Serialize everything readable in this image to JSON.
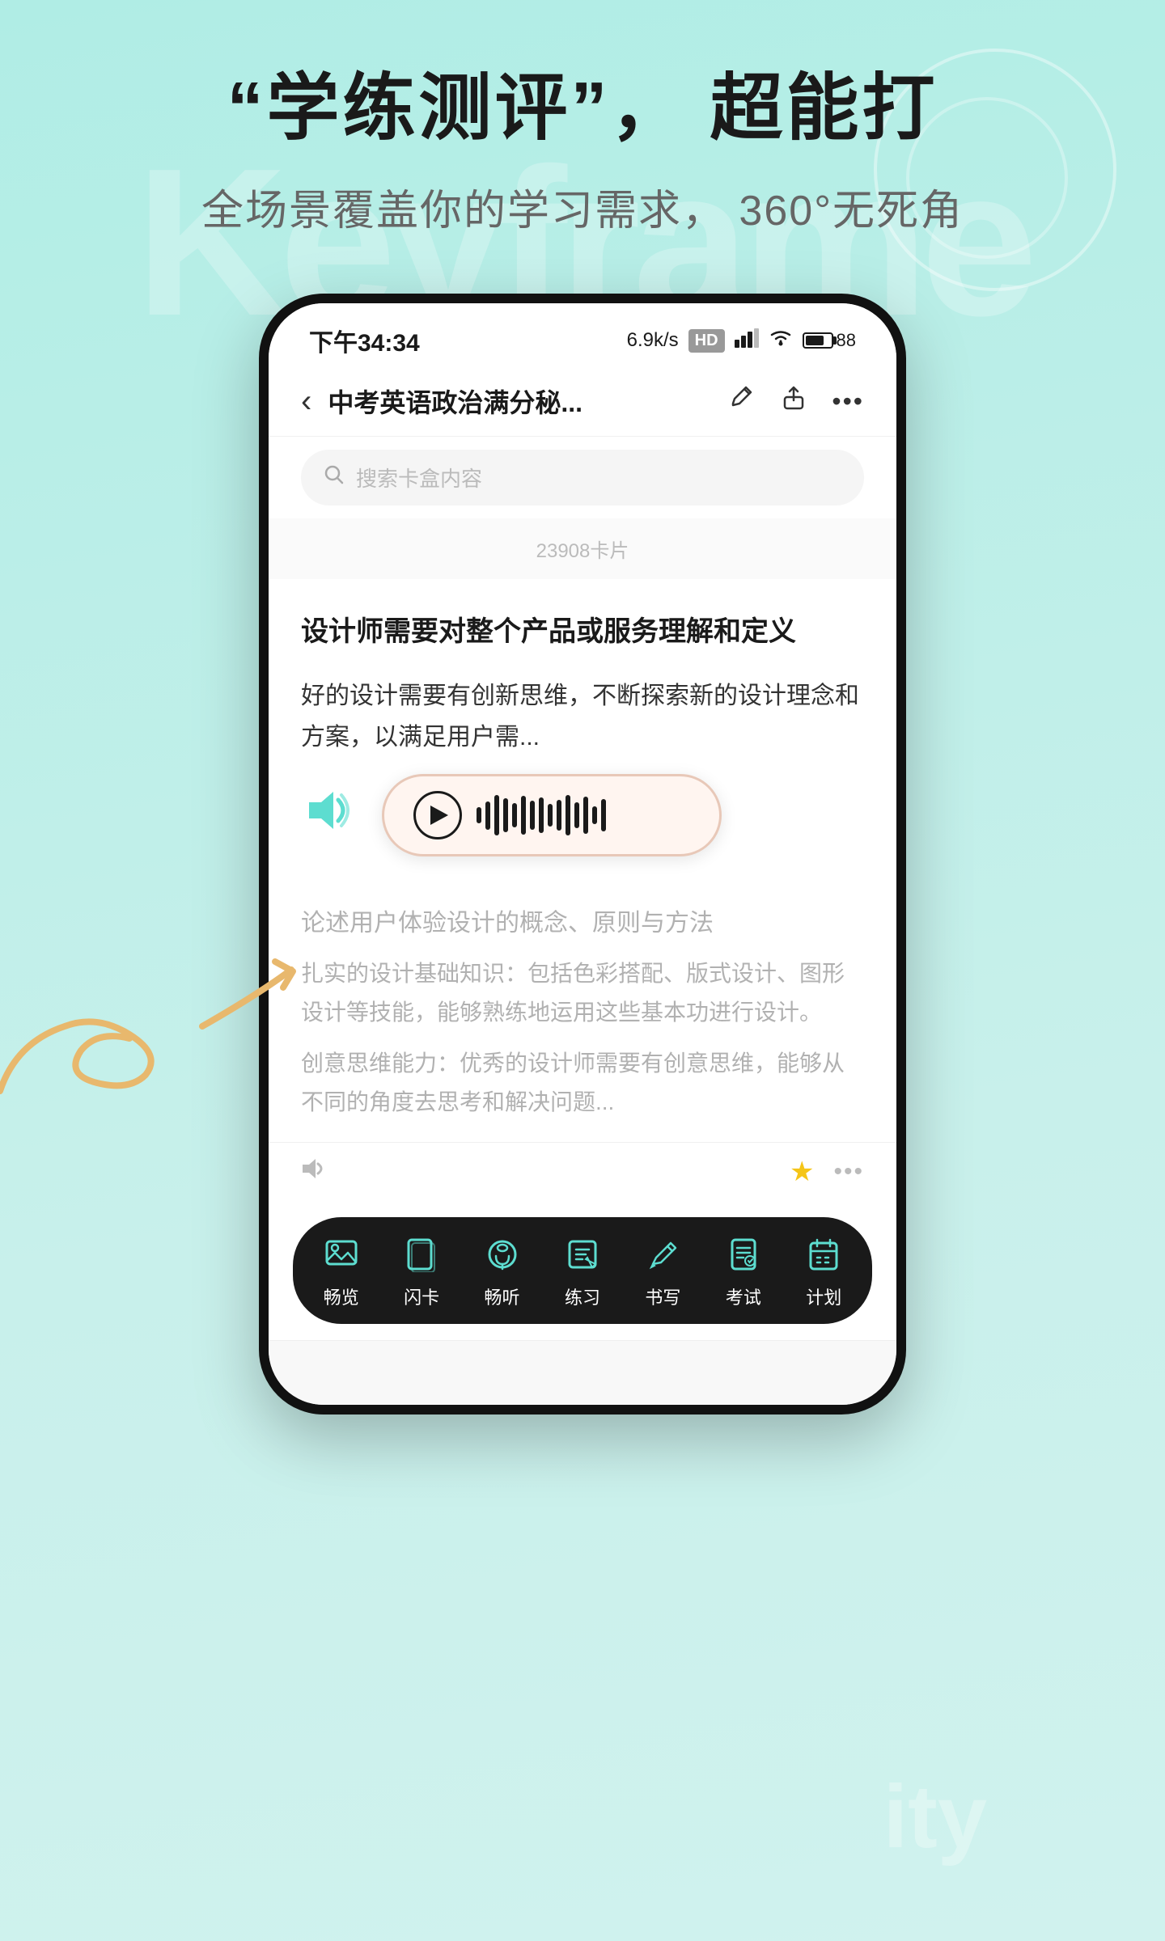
{
  "hero": {
    "title": "“学练测评”， 超能打",
    "subtitle": "全场景覆盖你的学习需求， 360°无死角",
    "watermark": "Keyframe"
  },
  "statusBar": {
    "time": "下午34:34",
    "speed": "6.9k/s",
    "hd": "HD",
    "signal": "███",
    "wifi": "●",
    "battery": "88"
  },
  "navBar": {
    "back": "‹",
    "title": "中考英语政治满分秘...",
    "editIcon": "✎",
    "shareIcon": "↗",
    "moreIcon": "•••"
  },
  "search": {
    "placeholder": "搜索卡盒内容"
  },
  "cardCount": {
    "text": "23908卡片"
  },
  "card1": {
    "question": "设计师需要对整个产品或服务理解和定义",
    "answer": "好的设计需要有创新思维，不断探索新的设计理念和方案，以满足用户需..."
  },
  "card2": {
    "question": "论述用户体验设计的概念、原则与方法",
    "answer1": "扎实的设计基础知识：包括色彩搭配、版式设计、图形设计等技能，能够熟练地运用这些基本功进行设计。",
    "answer2": "创意思维能力：优秀的设计师需要有创意思维，能够从不同的角度去思考和解决问题..."
  },
  "tabBar": {
    "items": [
      {
        "id": "browse",
        "label": "畅览",
        "icon": "browse"
      },
      {
        "id": "flashcard",
        "label": "闪卡",
        "icon": "flashcard"
      },
      {
        "id": "listen",
        "label": "畅听",
        "icon": "listen"
      },
      {
        "id": "practice",
        "label": "练习",
        "icon": "practice"
      },
      {
        "id": "write",
        "label": "书写",
        "icon": "write"
      },
      {
        "id": "exam",
        "label": "考试",
        "icon": "exam"
      },
      {
        "id": "plan",
        "label": "计划",
        "icon": "plan"
      }
    ]
  },
  "audioPlayer": {
    "waveHeights": [
      20,
      35,
      50,
      42,
      30,
      48,
      36,
      44,
      28,
      38,
      50,
      32,
      46,
      22,
      40
    ]
  },
  "detectedText": {
    "ity": "ity"
  }
}
